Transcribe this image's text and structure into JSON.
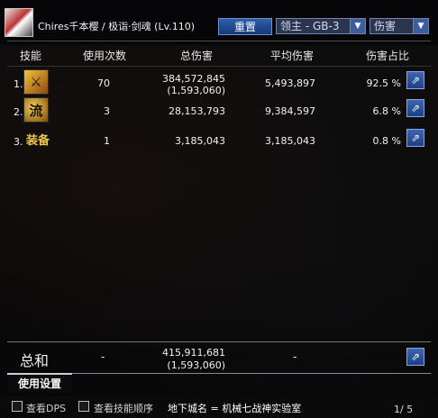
{
  "header": {
    "character_title": "Chires千本樱 / 极诣·剑魂 (Lv.110)",
    "reset_label": "重置",
    "target_dropdown": "领主 - GB-3",
    "type_dropdown": "伤害"
  },
  "columns": {
    "skill": "技能",
    "uses": "使用次数",
    "total": "总伤害",
    "avg": "平均伤害",
    "ratio": "伤害占比"
  },
  "rows": [
    {
      "rank": "1.",
      "icon": "skill-icon-slash",
      "uses": "70",
      "total": "384,572,845",
      "total_sub": "(1,593,060)",
      "avg": "5,493,897",
      "ratio": "92.5 %"
    },
    {
      "rank": "2.",
      "icon": "skill-icon-flow",
      "icon_text": "流",
      "uses": "3",
      "total": "28,153,793",
      "avg": "9,384,597",
      "ratio": "6.8 %"
    },
    {
      "rank": "3.",
      "skill_text": "装备",
      "uses": "1",
      "total": "3,185,043",
      "avg": "3,185,043",
      "ratio": "0.8 %"
    }
  ],
  "summary": {
    "label": "总和",
    "uses": "-",
    "total": "415,911,681",
    "total_sub": "(1,593,060)",
    "avg": "-"
  },
  "tabs": {
    "usage_settings": "使用设置"
  },
  "bottom": {
    "view_dps": "查看DPS",
    "view_skill_order": "查看技能顺序",
    "dungeon": "地下城名 = 机械七战神实验室",
    "page": "1/ 5"
  },
  "colors": {
    "button_blue": "#2d5fa8",
    "equip_text": "#f2c84b"
  }
}
